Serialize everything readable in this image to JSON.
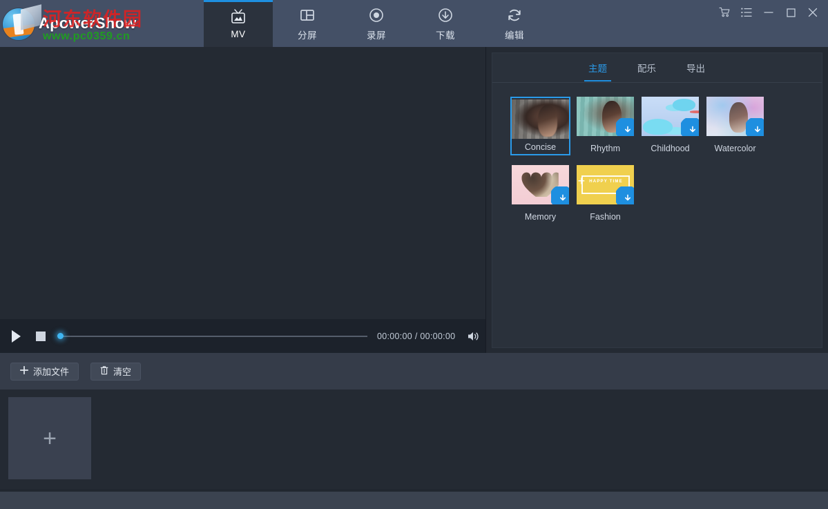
{
  "app": {
    "name": "ApowerShow",
    "watermark_cn": "河东软件园",
    "watermark_url": "www.pc0359.cn"
  },
  "header": {
    "tabs": [
      {
        "label": "MV",
        "icon": "tv-icon",
        "active": true
      },
      {
        "label": "分屏",
        "icon": "split-screen-icon",
        "active": false
      },
      {
        "label": "录屏",
        "icon": "record-icon",
        "active": false
      },
      {
        "label": "下载",
        "icon": "download-icon",
        "active": false
      },
      {
        "label": "编辑",
        "icon": "edit-refresh-icon",
        "active": false
      }
    ],
    "window_controls": [
      {
        "name": "cart-icon"
      },
      {
        "name": "menu-list-icon"
      },
      {
        "name": "minimize-icon"
      },
      {
        "name": "maximize-icon"
      },
      {
        "name": "close-icon"
      }
    ]
  },
  "player": {
    "play_label": "play-icon",
    "stop_label": "stop-icon",
    "volume_label": "volume-icon",
    "current_time": "00:00:00",
    "total_time": "00:00:00",
    "time_display": "00:00:00 / 00:00:00",
    "progress_percent": 0
  },
  "right_panel": {
    "tabs": [
      {
        "label": "主题",
        "active": true
      },
      {
        "label": "配乐",
        "active": false
      },
      {
        "label": "导出",
        "active": false
      }
    ],
    "themes": [
      {
        "name": "Concise",
        "selected": true,
        "downloadable": false,
        "art": "art-concise"
      },
      {
        "name": "Rhythm",
        "selected": false,
        "downloadable": true,
        "art": "art-rhythm"
      },
      {
        "name": "Childhood",
        "selected": false,
        "downloadable": true,
        "art": "art-childhood"
      },
      {
        "name": "Watercolor",
        "selected": false,
        "downloadable": true,
        "art": "art-watercolor"
      },
      {
        "name": "Memory",
        "selected": false,
        "downloadable": true,
        "art": "art-memory"
      },
      {
        "name": "Fashion",
        "selected": false,
        "downloadable": true,
        "art": "art-fashion"
      }
    ],
    "fashion_thumb_text": "HAPPY TIME"
  },
  "toolbar": {
    "add_file_label": "添加文件",
    "clear_label": "清空"
  },
  "timeline": {
    "add_media_label": "+"
  },
  "colors": {
    "accent": "#1e8fe0",
    "accent_text": "#2a9bea",
    "header_bg": "#445066",
    "panel_bg": "#2a313b",
    "canvas_bg": "#242a33",
    "toolstrip_bg": "#353c49",
    "player_bg": "#1c222b",
    "footer_bg": "#3b4350",
    "dropzone_bg": "#3a4150",
    "watermark_red": "#e02020",
    "watermark_green": "#1fa01f"
  }
}
